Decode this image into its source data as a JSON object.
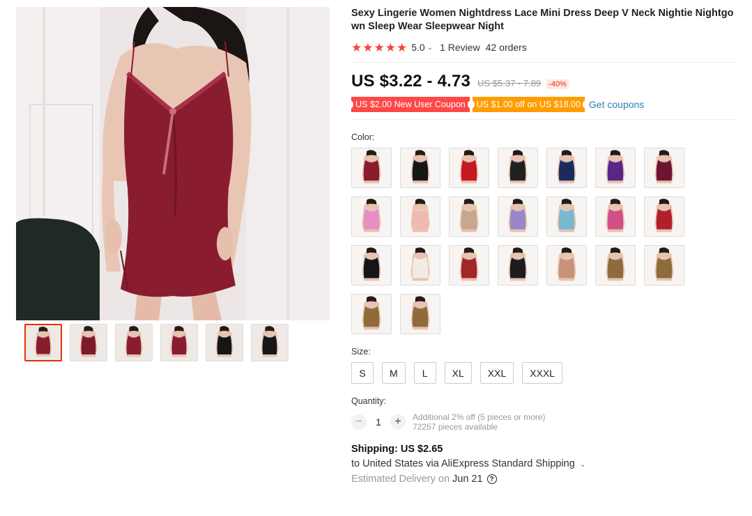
{
  "product": {
    "title": "Sexy Lingerie Women Nightdress Lace Mini Dress Deep V Neck Nightie Nightgown Sleep Wear Sleepwear Night",
    "rating": {
      "stars": 5,
      "score": "5.0",
      "reviews": "1 Review",
      "orders": "42 orders"
    }
  },
  "price": {
    "current": "US $3.22 - 4.73",
    "original": "US $5.37 - 7.89",
    "discount": "-40%"
  },
  "coupons": {
    "new_user": "US $2.00 New User Coupon",
    "threshold": "US $1.00 off on US $18.00",
    "get_coupons": "Get coupons"
  },
  "colors": {
    "label": "Color:",
    "items": [
      {
        "name": "burgundy",
        "dress": "#8a1c2f"
      },
      {
        "name": "black",
        "dress": "#161616"
      },
      {
        "name": "red",
        "dress": "#c41822"
      },
      {
        "name": "black-lace",
        "dress": "#202020"
      },
      {
        "name": "navy",
        "dress": "#1d2a5e"
      },
      {
        "name": "purple",
        "dress": "#5b2587"
      },
      {
        "name": "wine",
        "dress": "#6d1530"
      },
      {
        "name": "pink",
        "dress": "#e88ec3"
      },
      {
        "name": "nude-pink",
        "dress": "#f0b9b4"
      },
      {
        "name": "champagne",
        "dress": "#c9a78e"
      },
      {
        "name": "lavender",
        "dress": "#9a86c9"
      },
      {
        "name": "sky-blue",
        "dress": "#7ab8cf"
      },
      {
        "name": "rose",
        "dress": "#d14f86"
      },
      {
        "name": "red-tan",
        "dress": "#b0202b"
      },
      {
        "name": "black-white-lace",
        "dress": "#151515"
      },
      {
        "name": "white",
        "dress": "#f1ece2"
      },
      {
        "name": "red-set",
        "dress": "#a3262a"
      },
      {
        "name": "black-set",
        "dress": "#1c1c1c"
      },
      {
        "name": "tan-set",
        "dress": "#c9937a"
      },
      {
        "name": "leopard-black",
        "dress": "#8f6a3b"
      },
      {
        "name": "leopard-blue",
        "dress": "#8f6a3b"
      },
      {
        "name": "leopard-red",
        "dress": "#8f6a3b"
      },
      {
        "name": "leopard-purple",
        "dress": "#8f6a3b"
      }
    ]
  },
  "sizes": {
    "label": "Size:",
    "items": [
      "S",
      "M",
      "L",
      "XL",
      "XXL",
      "XXXL"
    ]
  },
  "quantity": {
    "label": "Quantity:",
    "value": "1",
    "minus": "−",
    "plus": "+",
    "discount_note": "Additional 2% off (5 pieces or more)",
    "available": "72257 pieces available"
  },
  "shipping": {
    "title": "Shipping: US $2.65",
    "destination": "to United States via AliExpress Standard Shipping",
    "chevron": "⌄",
    "delivery_prefix": "Estimated Delivery on",
    "delivery_date": "Jun 21",
    "help_glyph": "?"
  },
  "gallery": {
    "thumbnails": [
      {
        "name": "thumb-burgundy-front",
        "dress": "#8a1c2f"
      },
      {
        "name": "thumb-burgundy-chair",
        "dress": "#7d1a2b"
      },
      {
        "name": "thumb-burgundy-side",
        "dress": "#8a1c2f"
      },
      {
        "name": "thumb-burgundy-pose",
        "dress": "#8a1c2f"
      },
      {
        "name": "thumb-black-chair",
        "dress": "#161616"
      },
      {
        "name": "thumb-black-back",
        "dress": "#161616"
      }
    ]
  },
  "colors_theme": {
    "star": "#f44336",
    "coupon_red": "#ff4747",
    "coupon_orange": "#ff9c00",
    "link": "#2e7fb5",
    "active_thumb_border": "#e62e04"
  }
}
